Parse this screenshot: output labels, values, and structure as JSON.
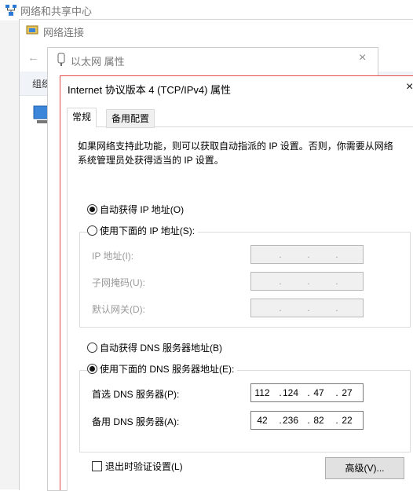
{
  "window_network_center": {
    "title": "网络和共享中心"
  },
  "window_network_connections": {
    "title": "网络连接",
    "toolbar_org": "组织"
  },
  "window_ethernet_props": {
    "title": "以太网 属性",
    "close": "×"
  },
  "dialog": {
    "title": "Internet 协议版本 4 (TCP/IPv4) 属性",
    "close": "×",
    "tabs": [
      "常规",
      "备用配置"
    ],
    "description": "如果网络支持此功能，则可以获取自动指派的 IP 设置。否则，你需要从网络系统管理员处获得适当的 IP 设置。",
    "ip": {
      "auto_label": "自动获得 IP 地址(O)",
      "manual_label": "使用下面的 IP 地址(S):",
      "auto_selected": true,
      "fields": [
        {
          "label": "IP 地址(I):",
          "octets": [
            "",
            "",
            "",
            ""
          ]
        },
        {
          "label": "子网掩码(U):",
          "octets": [
            "",
            "",
            "",
            ""
          ]
        },
        {
          "label": "默认网关(D):",
          "octets": [
            "",
            "",
            "",
            ""
          ]
        }
      ]
    },
    "dns": {
      "auto_label": "自动获得 DNS 服务器地址(B)",
      "manual_label": "使用下面的 DNS 服务器地址(E):",
      "manual_selected": true,
      "fields": [
        {
          "label": "首选 DNS 服务器(P):",
          "octets": [
            "112",
            "124",
            "47",
            "27"
          ]
        },
        {
          "label": "备用 DNS 服务器(A):",
          "octets": [
            "42",
            "236",
            "82",
            "22"
          ]
        }
      ]
    },
    "validate_on_exit": "退出时验证设置(L)",
    "advanced_button": "高级(V)..."
  },
  "colors": {
    "dialog_border": "#e34b4b"
  }
}
